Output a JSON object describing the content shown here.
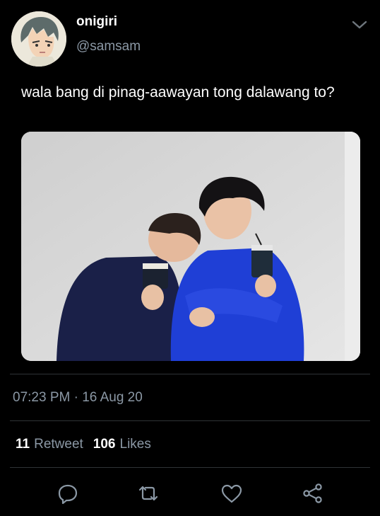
{
  "tweet": {
    "display_name": "onigiri",
    "handle": "@samsam",
    "text": "wala bang di pinag-aawayan tong dalawang to?",
    "timestamp": "07:23 PM · 16 Aug 20"
  },
  "stats": {
    "retweets": "11",
    "retweets_label": "Retweet",
    "likes": "106",
    "likes_label": "Likes"
  },
  "icons": {
    "reply": "speech-bubble",
    "retweet": "retweet-arrows",
    "like": "heart",
    "share": "share-nodes",
    "more": "chevron-down"
  },
  "colors": {
    "background": "#000000",
    "secondary_text": "#8b98a5",
    "divider": "#2f3336",
    "sweater_blue": "#1f3fd6",
    "sweater_navy": "#1a2048"
  }
}
